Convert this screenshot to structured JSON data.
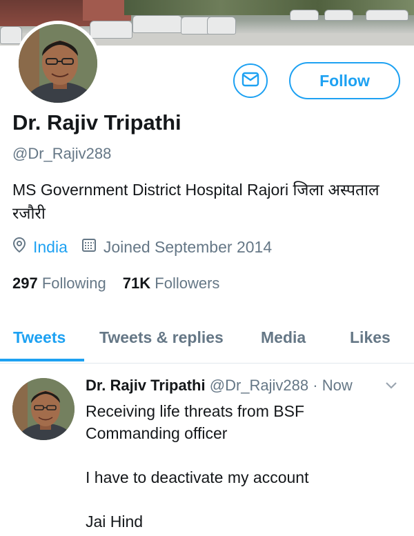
{
  "profile": {
    "name": "Dr. Rajiv Tripathi",
    "handle": "@Dr_Rajiv288",
    "bio": "MS Government District Hospital Rajori जिला अस्पताल रजौरी",
    "location": "India",
    "joined": "Joined September 2014",
    "following_count": "297",
    "following_label": "Following",
    "followers_count": "71K",
    "followers_label": "Followers"
  },
  "actions": {
    "follow_label": "Follow"
  },
  "tabs": [
    {
      "label": "Tweets",
      "active": true
    },
    {
      "label": "Tweets & replies",
      "active": false
    },
    {
      "label": "Media",
      "active": false
    },
    {
      "label": "Likes",
      "active": false
    }
  ],
  "tweet": {
    "author_name": "Dr. Rajiv Tripathi",
    "author_handle": "@Dr_Rajiv288",
    "separator": "·",
    "time": "Now",
    "lines": [
      "Receiving life threats from BSF",
      "Commanding officer",
      "I have to deactivate my account",
      "Jai Hind"
    ]
  },
  "icons": {
    "message": "envelope-icon",
    "location": "map-pin-icon",
    "calendar": "calendar-icon",
    "more": "chevron-down-icon"
  },
  "colors": {
    "accent": "#1da1f2",
    "text": "#14171a",
    "muted": "#657786"
  }
}
